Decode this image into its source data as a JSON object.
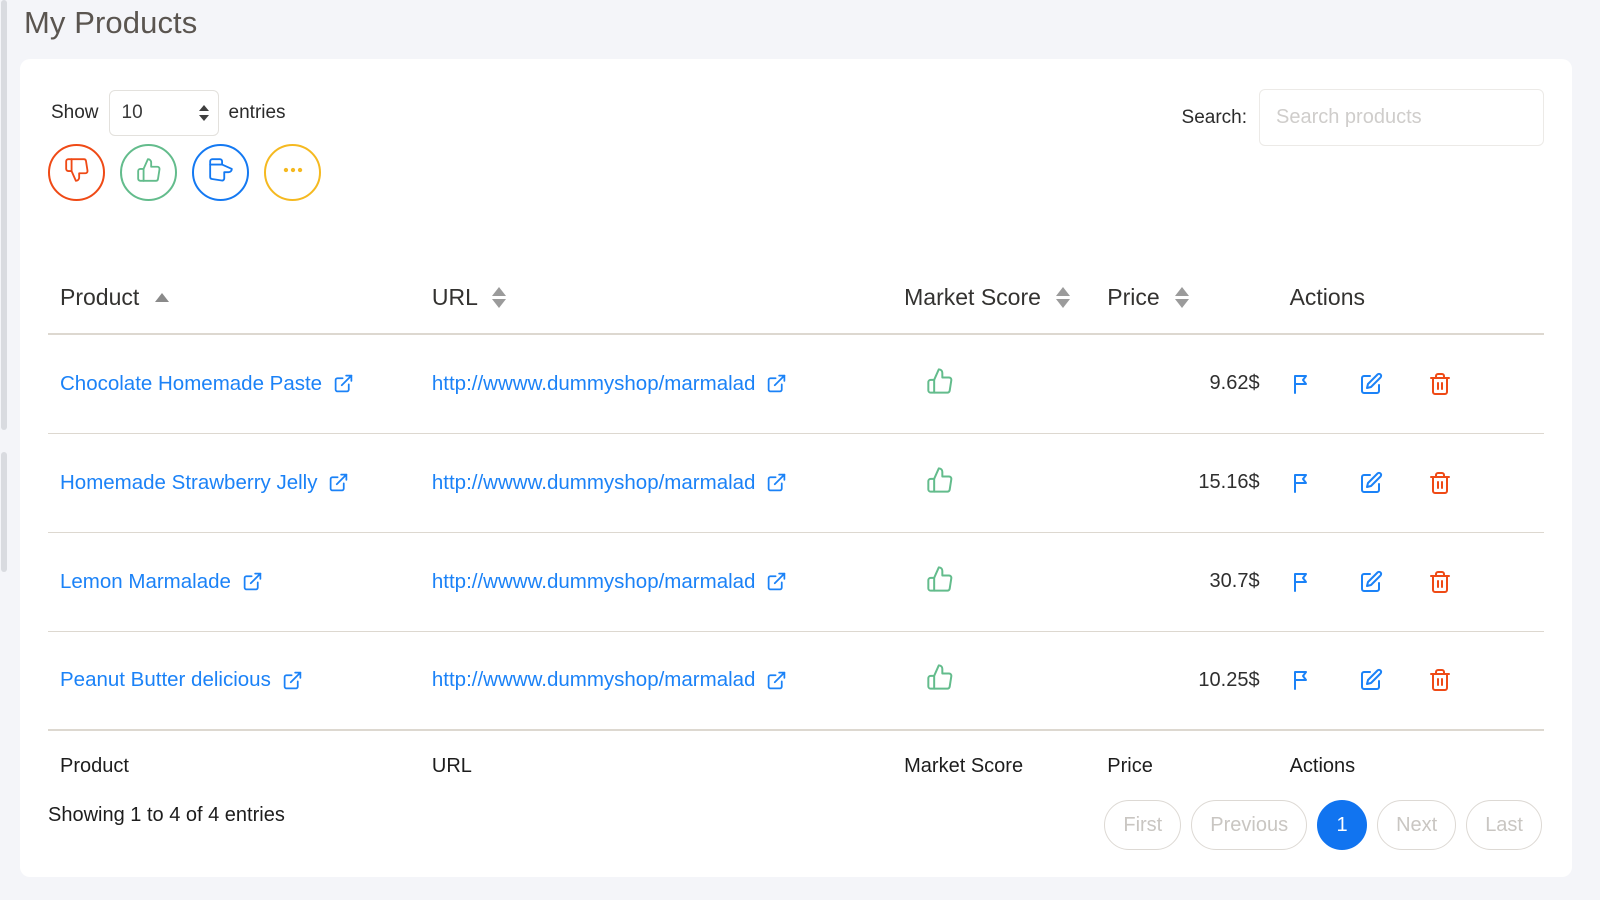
{
  "page": {
    "title": "My Products"
  },
  "controls": {
    "length_label": "Show",
    "length_value": "10",
    "entries_label": "entries",
    "search_label": "Search:",
    "search_value": "",
    "search_placeholder": "Search products"
  },
  "filters": [
    {
      "name": "thumbs-down-filter",
      "icon": "thumbs-down-icon",
      "color": "#ef4a16"
    },
    {
      "name": "thumbs-up-filter",
      "icon": "thumbs-up-icon",
      "color": "#63bc8c"
    },
    {
      "name": "pointing-hand-filter",
      "icon": "hand-point-right-icon",
      "color": "#1479f2"
    },
    {
      "name": "more-options-filter",
      "icon": "ellipsis-icon",
      "color": "#f5b920"
    }
  ],
  "table": {
    "headers": [
      {
        "label": "Product",
        "sort": "asc"
      },
      {
        "label": "URL",
        "sort": "none"
      },
      {
        "label": "Market Score",
        "sort": "none"
      },
      {
        "label": "Price",
        "sort": "none"
      },
      {
        "label": "Actions",
        "sort": null
      }
    ],
    "footer_headers": [
      "Product",
      "URL",
      "Market Score",
      "Price",
      "Actions"
    ],
    "rows": [
      {
        "product": "Chocolate Homemade Paste",
        "url": "http://wwww.dummyshop/marmalad",
        "score": "thumbs-up-icon",
        "price": "9.62$"
      },
      {
        "product": "Homemade Strawberry Jelly",
        "url": "http://wwww.dummyshop/marmalad",
        "score": "thumbs-up-icon",
        "price": "15.16$"
      },
      {
        "product": "Lemon Marmalade",
        "url": "http://wwww.dummyshop/marmalad",
        "score": "thumbs-up-icon",
        "price": "30.7$"
      },
      {
        "product": "Peanut Butter delicious",
        "url": "http://wwww.dummyshop/marmalad",
        "score": "thumbs-up-icon",
        "price": "10.25$"
      }
    ],
    "row_actions": [
      {
        "name": "flag-action",
        "icon": "flag-icon",
        "color": "#1b82f7"
      },
      {
        "name": "edit-action",
        "icon": "edit-icon",
        "color": "#1b82f7"
      },
      {
        "name": "delete-action",
        "icon": "trash-icon",
        "color": "#ef4a16"
      }
    ]
  },
  "footer": {
    "info": "Showing 1 to 4 of 4 entries",
    "pagination": [
      {
        "label": "First",
        "active": false
      },
      {
        "label": "Previous",
        "active": false
      },
      {
        "label": "1",
        "active": true
      },
      {
        "label": "Next",
        "active": false
      },
      {
        "label": "Last",
        "active": false
      }
    ]
  },
  "colors": {
    "accent_blue": "#1174f0",
    "link_blue": "#1b82f7",
    "green": "#63bc8c",
    "red": "#ef4a16",
    "yellow": "#f5b920",
    "page_bg": "#f4f5f9"
  }
}
